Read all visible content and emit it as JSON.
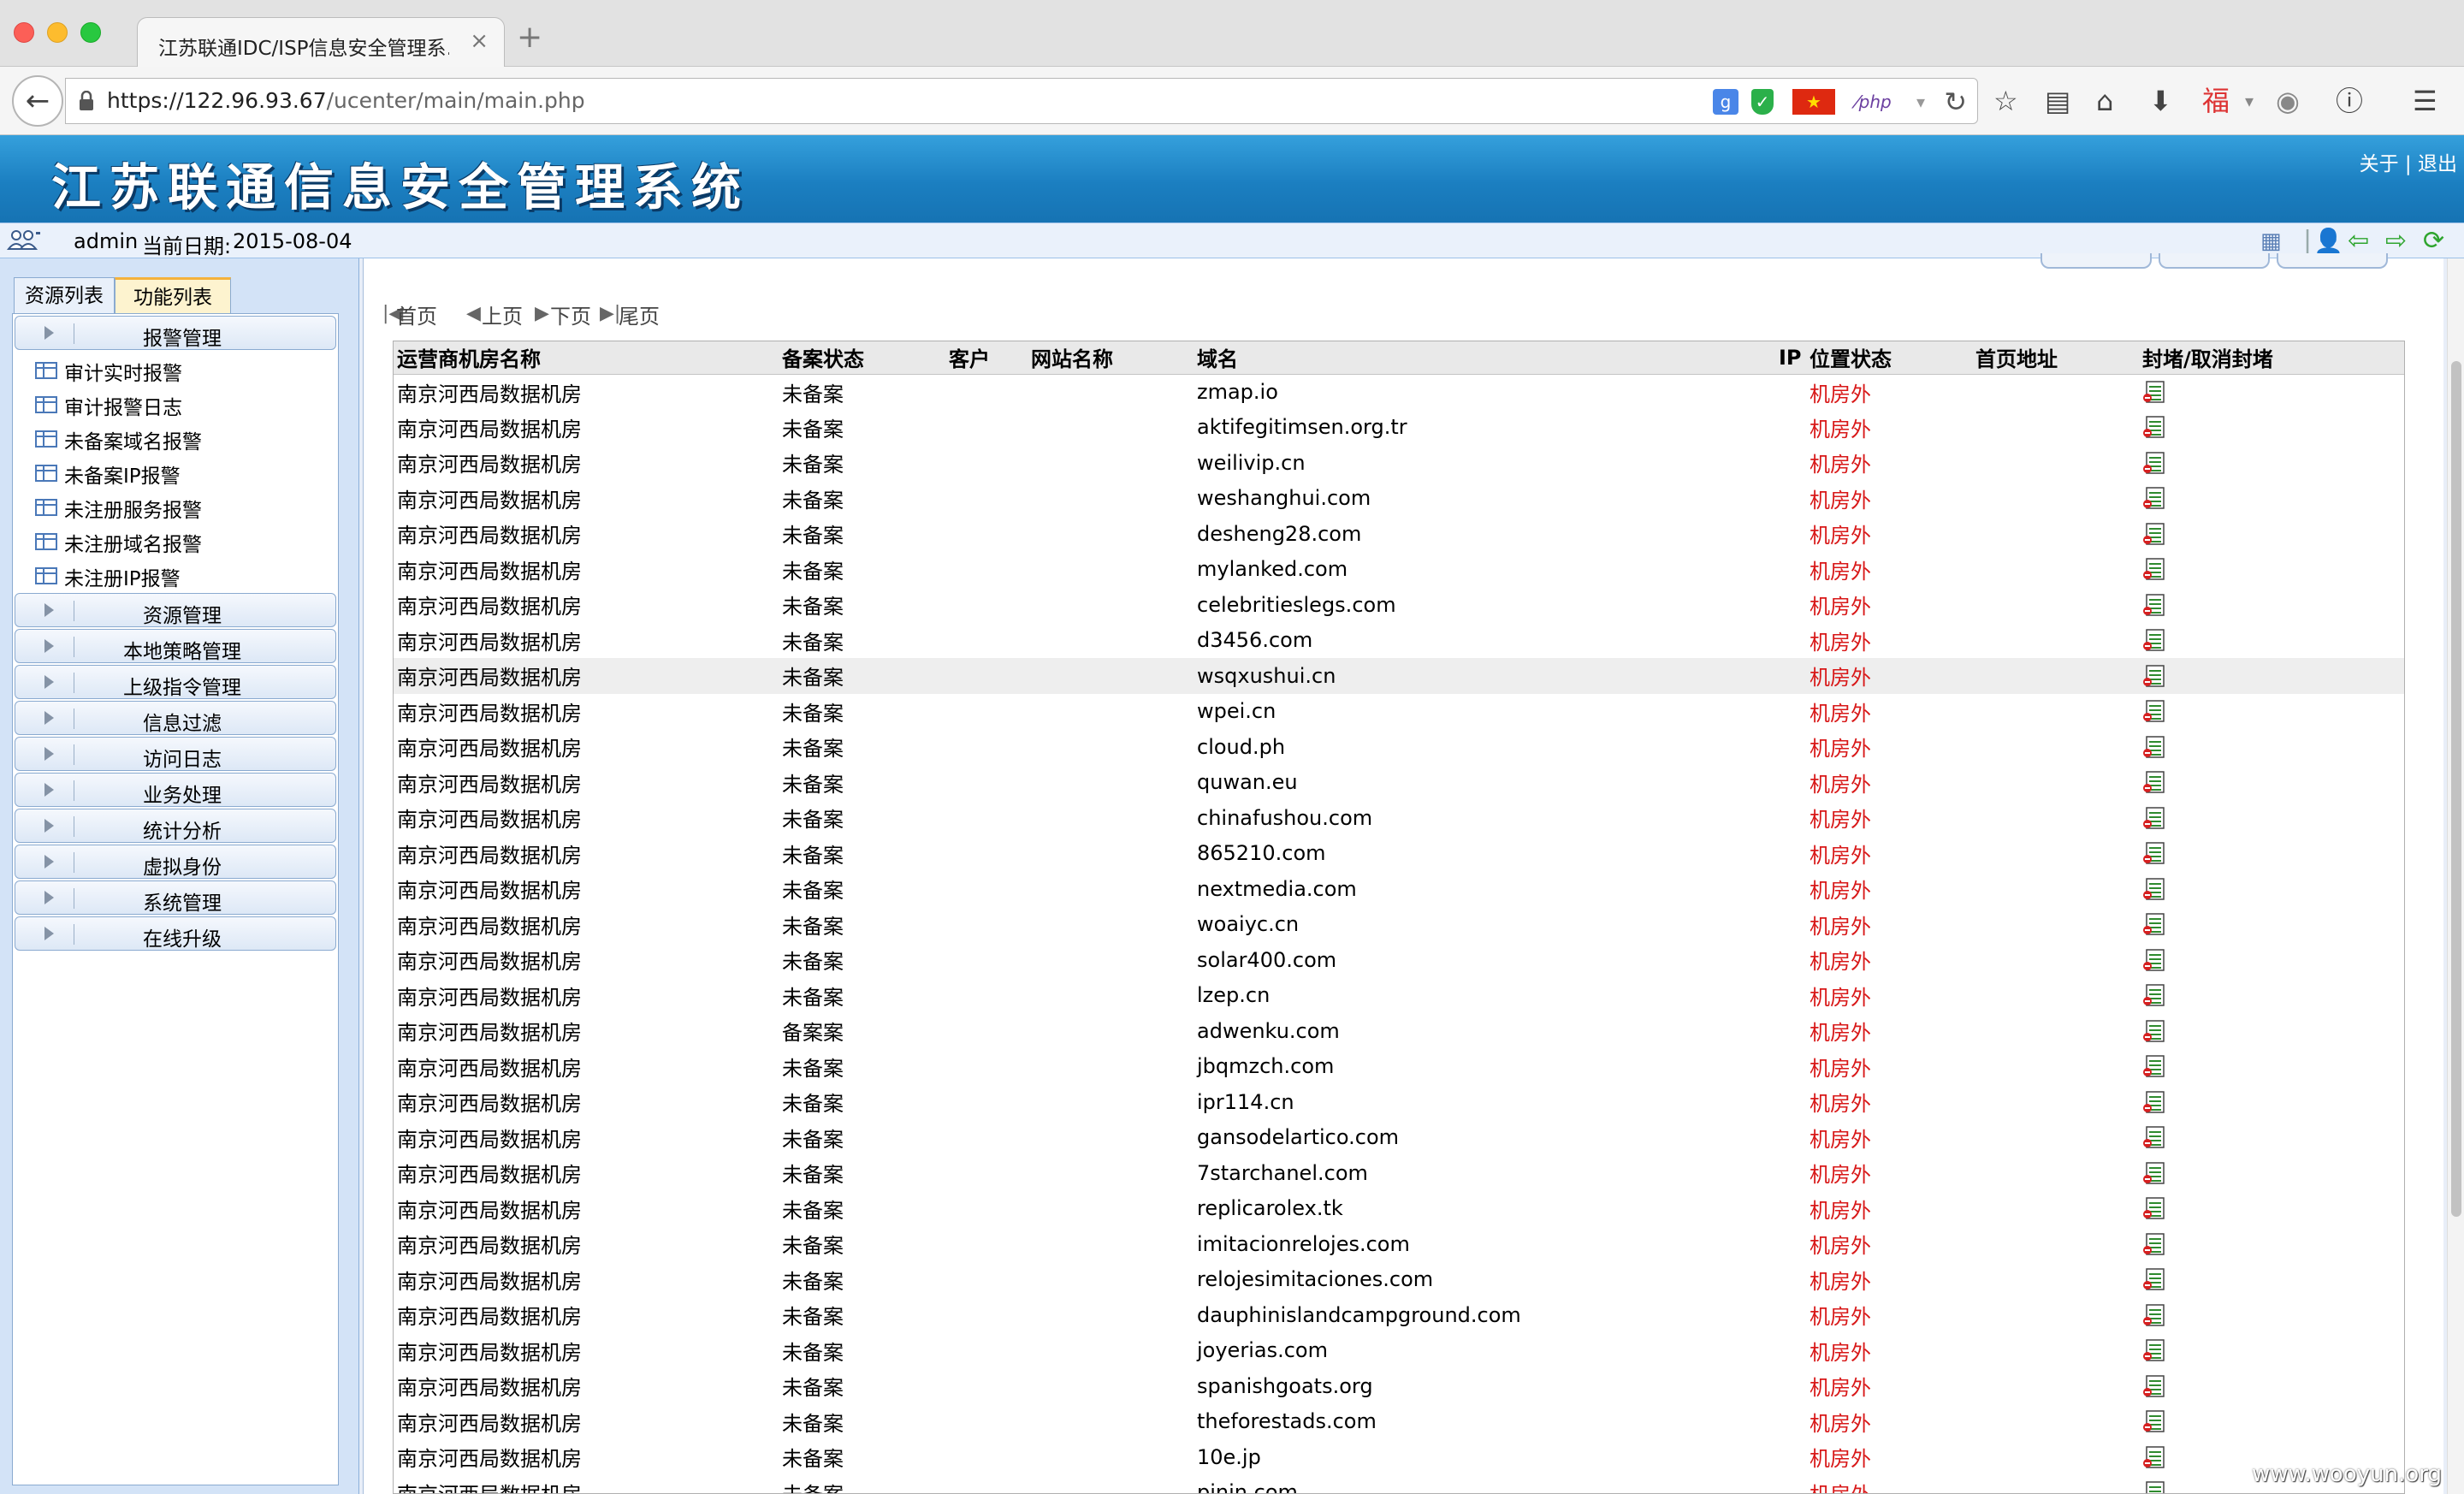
{
  "browser": {
    "tab_title": "江苏联通IDC/ISP信息安全管理系…",
    "tab_close": "×",
    "new_tab": "+",
    "url_host": "https://122.96.93.67",
    "url_path": "/ucenter/main/main.php"
  },
  "header": {
    "title": "江苏联通信息安全管理系统",
    "link_about": "关于",
    "link_sep": " | ",
    "link_logout": "退出"
  },
  "infobar": {
    "user": "admin",
    "date_label": "当前日期:",
    "date_value": "2015-08-04"
  },
  "panel": {
    "tab_resources": "资源列表",
    "tab_functions": "功能列表"
  },
  "menu": {
    "group_alarm": "报警管理",
    "alarm_items": [
      "审计实时报警",
      "审计报警日志",
      "未备案域名报警",
      "未备案IP报警",
      "未注册服务报警",
      "未注册域名报警",
      "未注册IP报警"
    ],
    "groups": [
      "资源管理",
      "本地策略管理",
      "上级指令管理",
      "信息过滤",
      "访问日志",
      "业务处理",
      "统计分析",
      "虚拟身份",
      "系统管理",
      "在线升级"
    ]
  },
  "pager": {
    "first": "首页",
    "prev": "上页",
    "next": "下页",
    "last": "尾页"
  },
  "table": {
    "headers": [
      "运营商机房名称",
      "备案状态",
      "客户",
      "网站名称",
      "域名",
      "IP",
      "位置状态",
      "首页地址",
      "封堵/取消封堵"
    ],
    "room": "南京河西局数据机房",
    "status_unfiled": "未备案",
    "status_filed": "备案案",
    "position": "机房外",
    "rows": [
      {
        "status": "未备案",
        "domain": "zmap.io"
      },
      {
        "status": "未备案",
        "domain": "aktifegitimsen.org.tr"
      },
      {
        "status": "未备案",
        "domain": "weilivip.cn"
      },
      {
        "status": "未备案",
        "domain": "weshanghui.com"
      },
      {
        "status": "未备案",
        "domain": "desheng28.com"
      },
      {
        "status": "未备案",
        "domain": "mylanked.com"
      },
      {
        "status": "未备案",
        "domain": "celebritieslegs.com"
      },
      {
        "status": "未备案",
        "domain": "d3456.com"
      },
      {
        "status": "未备案",
        "domain": "wsqxushui.cn"
      },
      {
        "status": "未备案",
        "domain": "wpei.cn"
      },
      {
        "status": "未备案",
        "domain": "cloud.ph"
      },
      {
        "status": "未备案",
        "domain": "quwan.eu"
      },
      {
        "status": "未备案",
        "domain": "chinafushou.com"
      },
      {
        "status": "未备案",
        "domain": "865210.com"
      },
      {
        "status": "未备案",
        "domain": "nextmedia.com"
      },
      {
        "status": "未备案",
        "domain": "woaiyc.cn"
      },
      {
        "status": "未备案",
        "domain": "solar400.com"
      },
      {
        "status": "未备案",
        "domain": "lzep.cn"
      },
      {
        "status": "备案案",
        "domain": "adwenku.com"
      },
      {
        "status": "未备案",
        "domain": "jbqmzch.com"
      },
      {
        "status": "未备案",
        "domain": "ipr114.cn"
      },
      {
        "status": "未备案",
        "domain": "gansodelartico.com"
      },
      {
        "status": "未备案",
        "domain": "7starchanel.com"
      },
      {
        "status": "未备案",
        "domain": "replicarolex.tk"
      },
      {
        "status": "未备案",
        "domain": "imitacionrelojes.com"
      },
      {
        "status": "未备案",
        "domain": "relojesimitaciones.com"
      },
      {
        "status": "未备案",
        "domain": "dauphinislandcampground.com"
      },
      {
        "status": "未备案",
        "domain": "joyerias.com"
      },
      {
        "status": "未备案",
        "domain": "spanishgoats.org"
      },
      {
        "status": "未备案",
        "domain": "theforestads.com"
      },
      {
        "status": "未备案",
        "domain": "10e.jp"
      },
      {
        "status": "未备案",
        "domain": "pinin.com"
      }
    ]
  },
  "watermark": "www.wooyun.org"
}
